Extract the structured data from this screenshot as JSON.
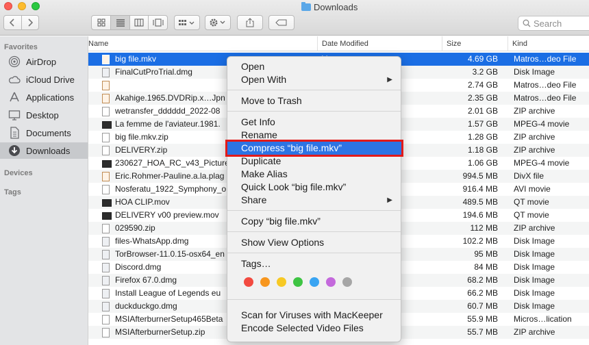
{
  "window": {
    "title": "Downloads"
  },
  "toolbar": {
    "search_placeholder": "Search"
  },
  "sidebar": {
    "favorites_heading": "Favorites",
    "devices_heading": "Devices",
    "tags_heading": "Tags",
    "items": [
      {
        "label": "AirDrop",
        "icon": "airdrop-icon"
      },
      {
        "label": "iCloud Drive",
        "icon": "cloud-icon"
      },
      {
        "label": "Applications",
        "icon": "applications-icon"
      },
      {
        "label": "Desktop",
        "icon": "desktop-icon"
      },
      {
        "label": "Documents",
        "icon": "document-icon"
      },
      {
        "label": "Downloads",
        "icon": "download-icon",
        "selected": true
      }
    ]
  },
  "list": {
    "columns": {
      "name": "Name",
      "date": "Date Modified",
      "size": "Size",
      "kind": "Kind"
    },
    "rows": [
      {
        "name": "big file.mkv",
        "date": "M",
        "size": "4.69 GB",
        "kind": "Matros…deo File",
        "type": "mkv",
        "selected": true
      },
      {
        "name": "FinalCutProTrial.dmg",
        "date": "PM",
        "size": "3.2 GB",
        "kind": "Disk Image",
        "type": "dmg"
      },
      {
        "name": "",
        "date": "PM",
        "size": "2.74 GB",
        "kind": "Matros…deo File",
        "type": "mkv"
      },
      {
        "name": "Akahige.1965.DVDRip.x…Jpn",
        "date": "PM",
        "size": "2.35 GB",
        "kind": "Matros…deo File",
        "type": "mkv"
      },
      {
        "name": "wetransfer_dddddd_2022-08",
        "date": "PM",
        "size": "2.01 GB",
        "kind": "ZIP archive",
        "type": "zip"
      },
      {
        "name": "La femme de l'aviateur.1981.",
        "date": "AM",
        "size": "1.57 GB",
        "kind": "MPEG-4 movie",
        "type": "movie"
      },
      {
        "name": "big file.mkv.zip",
        "date": "",
        "size": "1.28 GB",
        "kind": "ZIP archive",
        "type": "zip"
      },
      {
        "name": "DELIVERY.zip",
        "date": "PM",
        "size": "1.18 GB",
        "kind": "ZIP archive",
        "type": "zip"
      },
      {
        "name": "230627_HOA_RC_v43_Picture",
        "date": "PM",
        "size": "1.06 GB",
        "kind": "MPEG-4 movie",
        "type": "movie"
      },
      {
        "name": "Eric.Rohmer-Pauline.a.la.plag",
        "date": "PM",
        "size": "994.5 MB",
        "kind": "DivX file",
        "type": "mkv"
      },
      {
        "name": "Nosferatu_1922_Symphony_o",
        "date": "PM",
        "size": "916.4 MB",
        "kind": "AVI movie",
        "type": "zip"
      },
      {
        "name": "HOA CLIP.mov",
        "date": "AM",
        "size": "489.5 MB",
        "kind": "QT movie",
        "type": "movie"
      },
      {
        "name": "DELIVERY v00 preview.mov",
        "date": "AM",
        "size": "194.6 MB",
        "kind": "QT movie",
        "type": "movie"
      },
      {
        "name": "029590.zip",
        "date": "",
        "size": "112 MB",
        "kind": "ZIP archive",
        "type": "zip"
      },
      {
        "name": "files-WhatsApp.dmg",
        "date": "PM",
        "size": "102.2 MB",
        "kind": "Disk Image",
        "type": "dmg"
      },
      {
        "name": "TorBrowser-11.0.15-osx64_en",
        "date": "",
        "size": "95 MB",
        "kind": "Disk Image",
        "type": "dmg"
      },
      {
        "name": "Discord.dmg",
        "date": "",
        "size": "84 MB",
        "kind": "Disk Image",
        "type": "dmg"
      },
      {
        "name": "Firefox 67.0.dmg",
        "date": "",
        "size": "68.2 MB",
        "kind": "Disk Image",
        "type": "dmg"
      },
      {
        "name": "Install League of Legends eu",
        "date": "",
        "size": "66.2 MB",
        "kind": "Disk Image",
        "type": "dmg"
      },
      {
        "name": "duckduckgo.dmg",
        "date": "PM",
        "size": "60.7 MB",
        "kind": "Disk Image",
        "type": "dmg"
      },
      {
        "name": "MSIAfterburnerSetup465Beta",
        "date": "PM",
        "size": "55.9 MB",
        "kind": "Micros…lication",
        "type": "zip"
      },
      {
        "name": "MSIAfterburnerSetup.zip",
        "date": "PM",
        "size": "55.7 MB",
        "kind": "ZIP archive",
        "type": "zip"
      }
    ]
  },
  "context_menu": {
    "open": "Open",
    "open_with": "Open With",
    "move_to_trash": "Move to Trash",
    "get_info": "Get Info",
    "rename": "Rename",
    "compress": "Compress “big file.mkv”",
    "duplicate": "Duplicate",
    "make_alias": "Make Alias",
    "quick_look": "Quick Look “big file.mkv”",
    "share": "Share",
    "copy": "Copy “big file.mkv”",
    "show_view_options": "Show View Options",
    "tags": "Tags…",
    "scan_viruses": "Scan for Viruses with MacKeeper",
    "encode_video": "Encode Selected Video Files",
    "tag_colors": [
      "#f24a40",
      "#f7961e",
      "#f7c924",
      "#3ec443",
      "#39a4f2",
      "#c469dc",
      "#a6a6a6"
    ]
  }
}
